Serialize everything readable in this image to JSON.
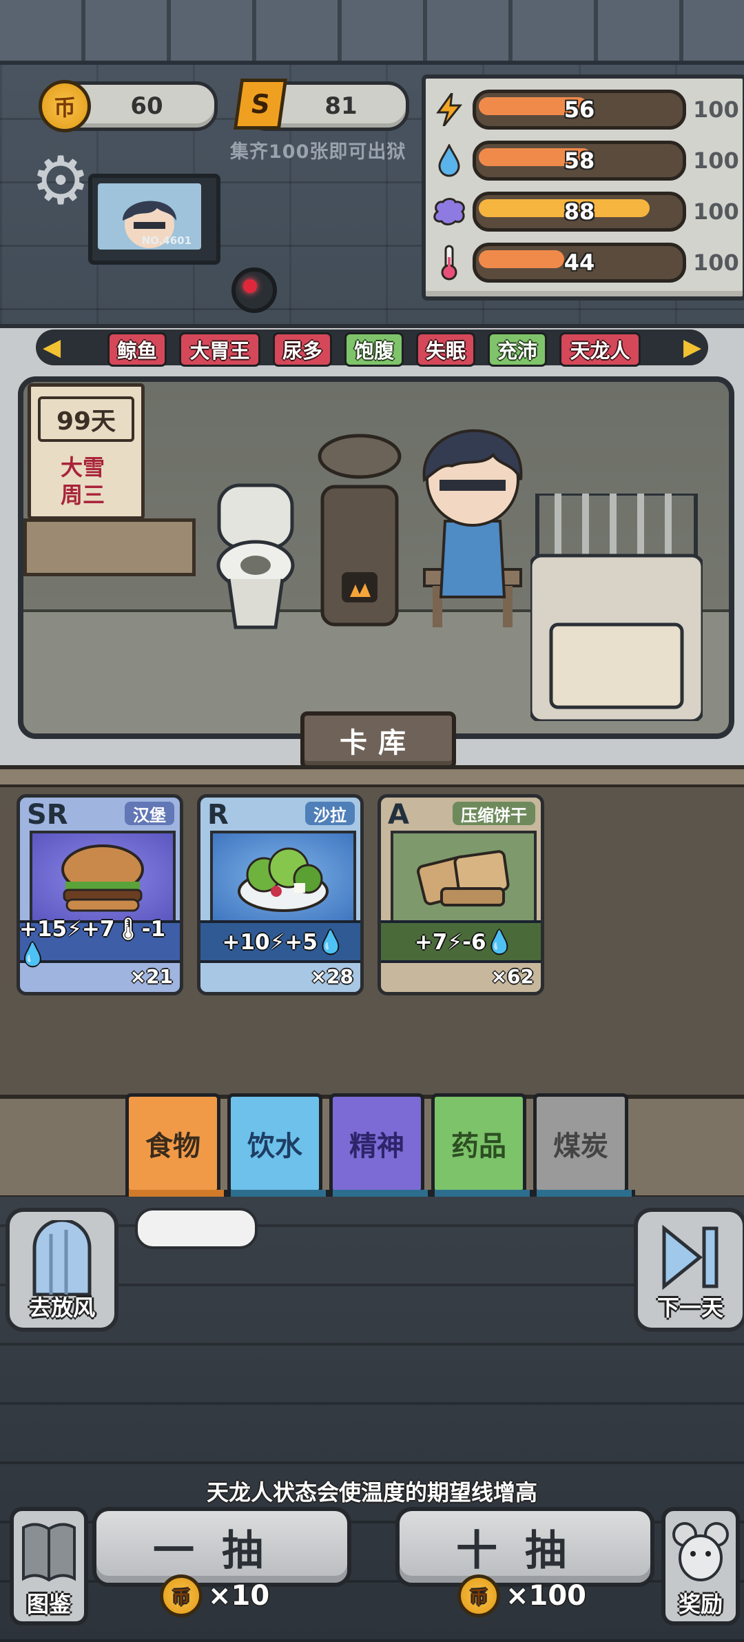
{
  "currency": {
    "coin_icon": "币",
    "coin_value": "60",
    "ticket_icon": "S",
    "ticket_value": "81",
    "collect_hint": "集齐100张即可出狱"
  },
  "stats": [
    {
      "icon": "lightning-icon",
      "glyph": "⚡",
      "value": "56",
      "max": "100",
      "fill": 0.56,
      "color": "#f08a4b"
    },
    {
      "icon": "water-drop-icon",
      "glyph": "💧",
      "value": "58",
      "max": "100",
      "fill": 0.58,
      "color": "#f08a4b"
    },
    {
      "icon": "brain-icon",
      "glyph": "🧠",
      "value": "88",
      "max": "100",
      "fill": 0.88,
      "color": "#f6b53f"
    },
    {
      "icon": "thermometer-icon",
      "glyph": "🌡",
      "value": "44",
      "max": "100",
      "fill": 0.44,
      "color": "#f08a4b"
    }
  ],
  "monitor": {
    "label": "NO.4601"
  },
  "tags": [
    {
      "label": "鲸鱼",
      "color": "red"
    },
    {
      "label": "大胃王",
      "color": "red"
    },
    {
      "label": "尿多",
      "color": "red"
    },
    {
      "label": "饱腹",
      "color": "green"
    },
    {
      "label": "失眠",
      "color": "red"
    },
    {
      "label": "充沛",
      "color": "green"
    },
    {
      "label": "天龙人",
      "color": "red"
    }
  ],
  "calendar": {
    "day": "99天",
    "weather": "大雪",
    "weekday": "周三"
  },
  "section_title": "卡库",
  "cards": [
    {
      "rank": "SR",
      "name": "汉堡",
      "effects": "+15⚡+7🌡-1💧",
      "count": "×21"
    },
    {
      "rank": "R",
      "name": "沙拉",
      "effects": "+10⚡+5💧",
      "count": "×28"
    },
    {
      "rank": "A",
      "name": "压缩饼干",
      "effects": "+7⚡-6💧",
      "count": "×62"
    }
  ],
  "categories": [
    {
      "label": "食物",
      "selected": true
    },
    {
      "label": "饮水",
      "selected": false
    },
    {
      "label": "精神",
      "selected": false
    },
    {
      "label": "药品",
      "selected": false
    },
    {
      "label": "煤炭",
      "selected": false
    }
  ],
  "buttons": {
    "go_out": "去放风",
    "next_day": "下一天",
    "handbook": "图鉴",
    "reward": "奖励",
    "draw_one": "一抽",
    "draw_ten": "十抽",
    "cost_one": "×10",
    "cost_ten": "×100"
  },
  "hint": "天龙人状态会使温度的期望线增高"
}
